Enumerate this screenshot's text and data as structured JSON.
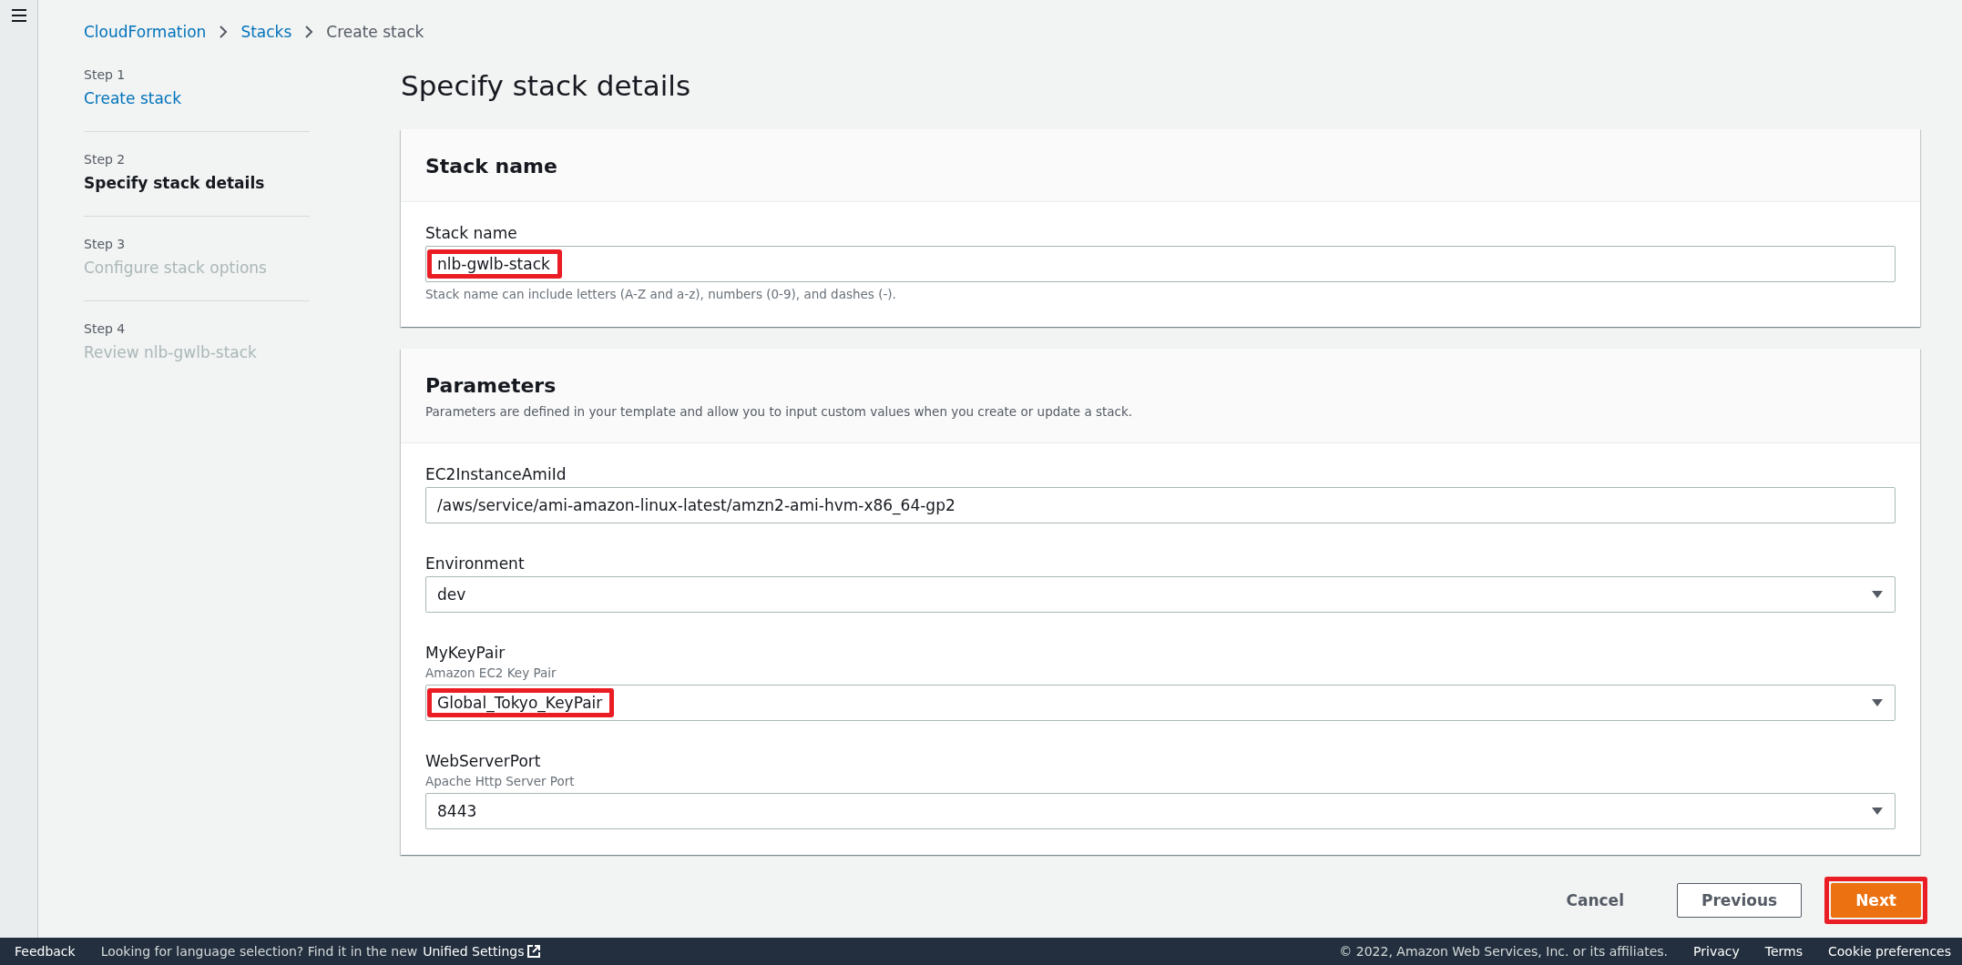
{
  "breadcrumb": [
    {
      "label": "CloudFormation",
      "link": true
    },
    {
      "label": "Stacks",
      "link": true
    },
    {
      "label": "Create stack",
      "link": false
    }
  ],
  "steps": [
    {
      "step": "Step 1",
      "label": "Create stack",
      "selected": false,
      "disabled": false
    },
    {
      "step": "Step 2",
      "label": "Specify stack details",
      "selected": true,
      "disabled": false
    },
    {
      "step": "Step 3",
      "label": "Configure stack options",
      "selected": false,
      "disabled": true
    },
    {
      "step": "Step 4",
      "label": "Review nlb-gwlb-stack",
      "selected": false,
      "disabled": true
    }
  ],
  "page_title": "Specify stack details",
  "stack_name_panel": {
    "title": "Stack name",
    "field": {
      "label": "Stack name",
      "value": "nlb-gwlb-stack",
      "kind": "text",
      "highlighted": true,
      "hint": "Stack name can include letters (A-Z and a-z), numbers (0-9), and dashes (-)."
    }
  },
  "parameters_panel": {
    "title": "Parameters",
    "description": "Parameters are defined in your template and allow you to input custom values when you create or update a stack.",
    "fields": [
      {
        "label": "EC2InstanceAmiId",
        "value": "/aws/service/ami-amazon-linux-latest/amzn2-ami-hvm-x86_64-gp2",
        "kind": "text",
        "highlighted": false
      },
      {
        "label": "Environment",
        "value": "dev",
        "kind": "select",
        "highlighted": false
      },
      {
        "label": "MyKeyPair",
        "description": "Amazon EC2 Key Pair",
        "value": "Global_Tokyo_KeyPair",
        "kind": "select",
        "highlighted": true
      },
      {
        "label": "WebServerPort",
        "description": "Apache Http Server Port",
        "value": "8443",
        "kind": "select",
        "highlighted": false
      }
    ]
  },
  "actions": [
    {
      "label": "Cancel",
      "kind": "link",
      "highlighted": false
    },
    {
      "label": "Previous",
      "kind": "secondary",
      "highlighted": false
    },
    {
      "label": "Next",
      "kind": "primary",
      "highlighted": true
    }
  ],
  "footer": {
    "feedback": "Feedback",
    "language_note": "Looking for language selection? Find it in the new",
    "settings_link": "Unified Settings",
    "copyright": "© 2022, Amazon Web Services, Inc. or its affiliates.",
    "links": [
      "Privacy",
      "Terms",
      "Cookie preferences"
    ]
  }
}
